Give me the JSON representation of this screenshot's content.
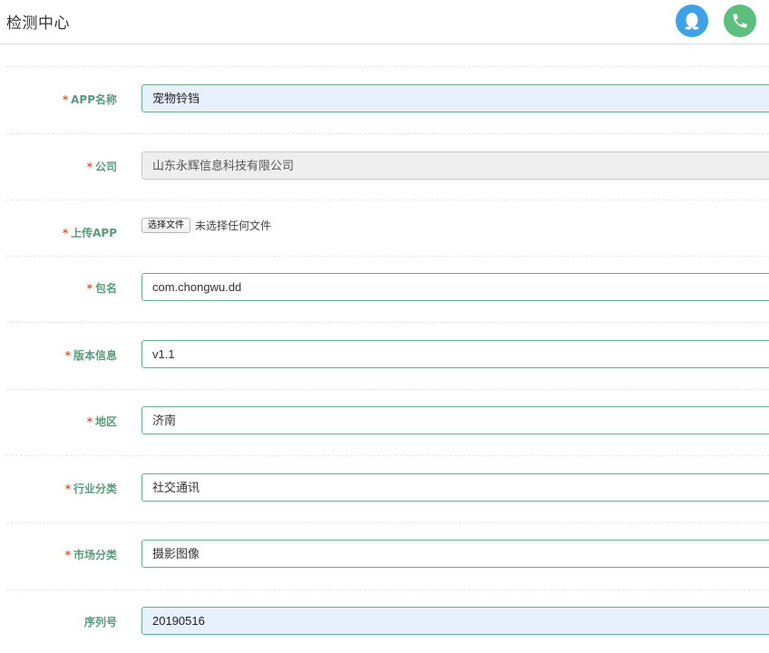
{
  "header": {
    "title": "检测中心",
    "qq_icon": "qq-penguin-icon",
    "phone_icon": "phone-icon",
    "qq_color": "#3ea2e8",
    "phone_color": "#5cbf7d"
  },
  "form": {
    "required_mark": "*",
    "app_name": {
      "label": "APP名称",
      "value": "宠物铃铛"
    },
    "company": {
      "label": "公司",
      "value": "山东永辉信息科技有限公司"
    },
    "upload": {
      "label": "上传APP",
      "button": "选择文件",
      "status": "未选择任何文件"
    },
    "package": {
      "label": "包名",
      "value": "com.chongwu.dd"
    },
    "version": {
      "label": "版本信息",
      "value": "v1.1"
    },
    "region": {
      "label": "地区",
      "value": "济南"
    },
    "industry": {
      "label": "行业分类",
      "value": "社交通讯"
    },
    "market": {
      "label": "市场分类",
      "value": "摄影图像"
    },
    "serial": {
      "label": "序列号",
      "value": "20190516"
    }
  }
}
